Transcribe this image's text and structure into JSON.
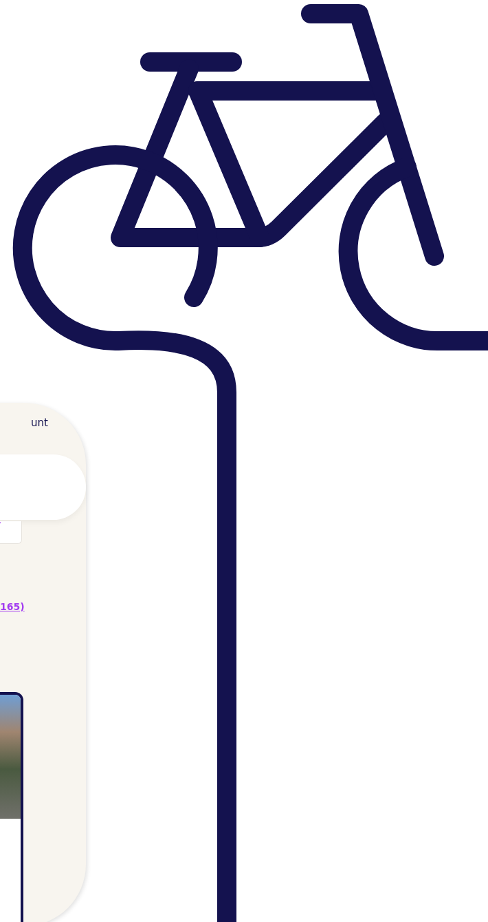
{
  "phone": {
    "header_text": "unt",
    "link": "165)"
  }
}
